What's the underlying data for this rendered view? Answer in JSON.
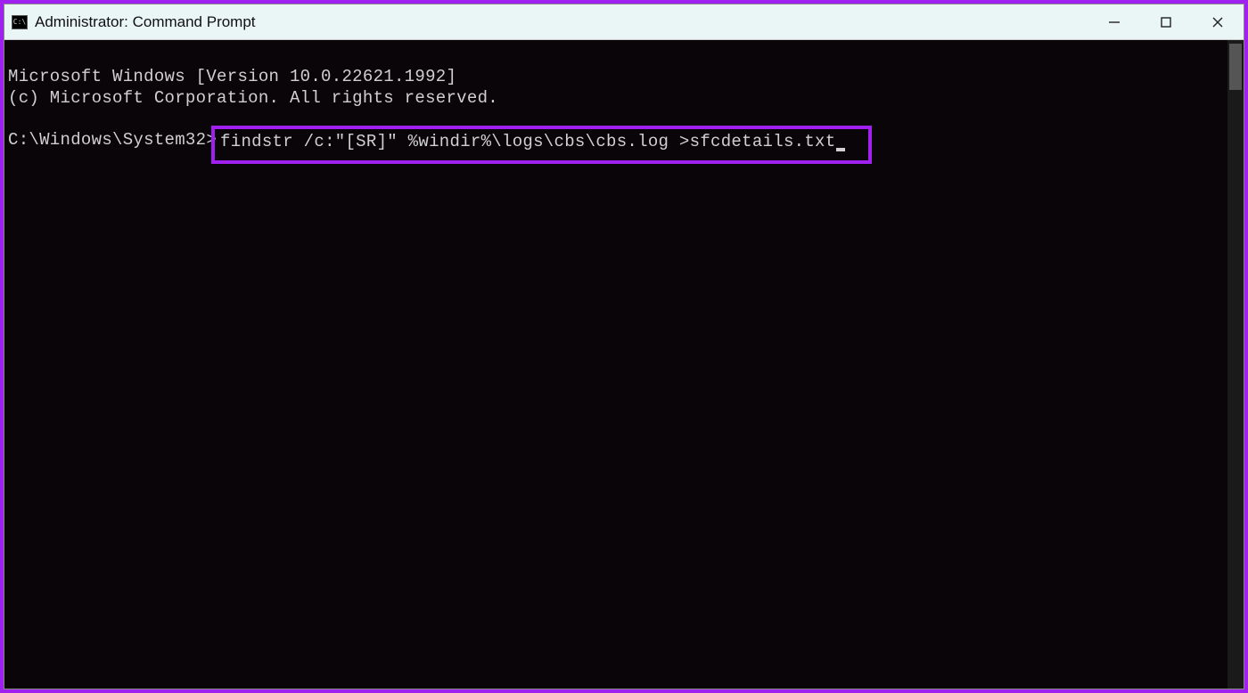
{
  "titlebar": {
    "title": "Administrator: Command Prompt",
    "icon_label": "C:\\"
  },
  "terminal": {
    "line1": "Microsoft Windows [Version 10.0.22621.1992]",
    "line2": "(c) Microsoft Corporation. All rights reserved.",
    "prompt": "C:\\Windows\\System32>",
    "command": "findstr /c:\"[SR]\" %windir%\\logs\\cbs\\cbs.log >sfcdetails.txt"
  },
  "colors": {
    "highlight_border": "#a020f0",
    "terminal_bg": "#0a0508",
    "terminal_fg": "#d0d0d0",
    "titlebar_bg": "#eaf5f5"
  }
}
